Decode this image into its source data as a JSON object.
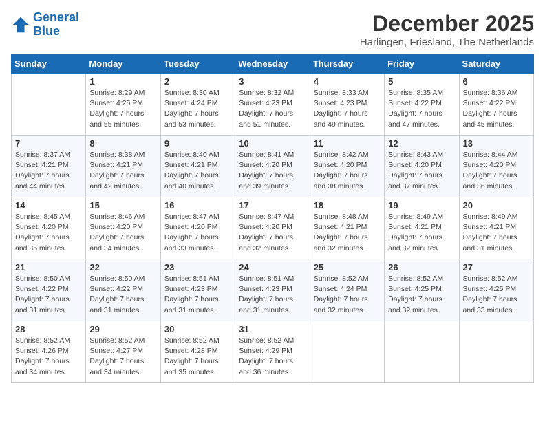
{
  "logo": {
    "line1": "General",
    "line2": "Blue"
  },
  "title": "December 2025",
  "location": "Harlingen, Friesland, The Netherlands",
  "days_of_week": [
    "Sunday",
    "Monday",
    "Tuesday",
    "Wednesday",
    "Thursday",
    "Friday",
    "Saturday"
  ],
  "weeks": [
    [
      {
        "num": "",
        "info": ""
      },
      {
        "num": "1",
        "info": "Sunrise: 8:29 AM\nSunset: 4:25 PM\nDaylight: 7 hours\nand 55 minutes."
      },
      {
        "num": "2",
        "info": "Sunrise: 8:30 AM\nSunset: 4:24 PM\nDaylight: 7 hours\nand 53 minutes."
      },
      {
        "num": "3",
        "info": "Sunrise: 8:32 AM\nSunset: 4:23 PM\nDaylight: 7 hours\nand 51 minutes."
      },
      {
        "num": "4",
        "info": "Sunrise: 8:33 AM\nSunset: 4:23 PM\nDaylight: 7 hours\nand 49 minutes."
      },
      {
        "num": "5",
        "info": "Sunrise: 8:35 AM\nSunset: 4:22 PM\nDaylight: 7 hours\nand 47 minutes."
      },
      {
        "num": "6",
        "info": "Sunrise: 8:36 AM\nSunset: 4:22 PM\nDaylight: 7 hours\nand 45 minutes."
      }
    ],
    [
      {
        "num": "7",
        "info": "Sunrise: 8:37 AM\nSunset: 4:21 PM\nDaylight: 7 hours\nand 44 minutes."
      },
      {
        "num": "8",
        "info": "Sunrise: 8:38 AM\nSunset: 4:21 PM\nDaylight: 7 hours\nand 42 minutes."
      },
      {
        "num": "9",
        "info": "Sunrise: 8:40 AM\nSunset: 4:21 PM\nDaylight: 7 hours\nand 40 minutes."
      },
      {
        "num": "10",
        "info": "Sunrise: 8:41 AM\nSunset: 4:20 PM\nDaylight: 7 hours\nand 39 minutes."
      },
      {
        "num": "11",
        "info": "Sunrise: 8:42 AM\nSunset: 4:20 PM\nDaylight: 7 hours\nand 38 minutes."
      },
      {
        "num": "12",
        "info": "Sunrise: 8:43 AM\nSunset: 4:20 PM\nDaylight: 7 hours\nand 37 minutes."
      },
      {
        "num": "13",
        "info": "Sunrise: 8:44 AM\nSunset: 4:20 PM\nDaylight: 7 hours\nand 36 minutes."
      }
    ],
    [
      {
        "num": "14",
        "info": "Sunrise: 8:45 AM\nSunset: 4:20 PM\nDaylight: 7 hours\nand 35 minutes."
      },
      {
        "num": "15",
        "info": "Sunrise: 8:46 AM\nSunset: 4:20 PM\nDaylight: 7 hours\nand 34 minutes."
      },
      {
        "num": "16",
        "info": "Sunrise: 8:47 AM\nSunset: 4:20 PM\nDaylight: 7 hours\nand 33 minutes."
      },
      {
        "num": "17",
        "info": "Sunrise: 8:47 AM\nSunset: 4:20 PM\nDaylight: 7 hours\nand 32 minutes."
      },
      {
        "num": "18",
        "info": "Sunrise: 8:48 AM\nSunset: 4:21 PM\nDaylight: 7 hours\nand 32 minutes."
      },
      {
        "num": "19",
        "info": "Sunrise: 8:49 AM\nSunset: 4:21 PM\nDaylight: 7 hours\nand 32 minutes."
      },
      {
        "num": "20",
        "info": "Sunrise: 8:49 AM\nSunset: 4:21 PM\nDaylight: 7 hours\nand 31 minutes."
      }
    ],
    [
      {
        "num": "21",
        "info": "Sunrise: 8:50 AM\nSunset: 4:22 PM\nDaylight: 7 hours\nand 31 minutes."
      },
      {
        "num": "22",
        "info": "Sunrise: 8:50 AM\nSunset: 4:22 PM\nDaylight: 7 hours\nand 31 minutes."
      },
      {
        "num": "23",
        "info": "Sunrise: 8:51 AM\nSunset: 4:23 PM\nDaylight: 7 hours\nand 31 minutes."
      },
      {
        "num": "24",
        "info": "Sunrise: 8:51 AM\nSunset: 4:23 PM\nDaylight: 7 hours\nand 31 minutes."
      },
      {
        "num": "25",
        "info": "Sunrise: 8:52 AM\nSunset: 4:24 PM\nDaylight: 7 hours\nand 32 minutes."
      },
      {
        "num": "26",
        "info": "Sunrise: 8:52 AM\nSunset: 4:25 PM\nDaylight: 7 hours\nand 32 minutes."
      },
      {
        "num": "27",
        "info": "Sunrise: 8:52 AM\nSunset: 4:25 PM\nDaylight: 7 hours\nand 33 minutes."
      }
    ],
    [
      {
        "num": "28",
        "info": "Sunrise: 8:52 AM\nSunset: 4:26 PM\nDaylight: 7 hours\nand 34 minutes."
      },
      {
        "num": "29",
        "info": "Sunrise: 8:52 AM\nSunset: 4:27 PM\nDaylight: 7 hours\nand 34 minutes."
      },
      {
        "num": "30",
        "info": "Sunrise: 8:52 AM\nSunset: 4:28 PM\nDaylight: 7 hours\nand 35 minutes."
      },
      {
        "num": "31",
        "info": "Sunrise: 8:52 AM\nSunset: 4:29 PM\nDaylight: 7 hours\nand 36 minutes."
      },
      {
        "num": "",
        "info": ""
      },
      {
        "num": "",
        "info": ""
      },
      {
        "num": "",
        "info": ""
      }
    ]
  ]
}
